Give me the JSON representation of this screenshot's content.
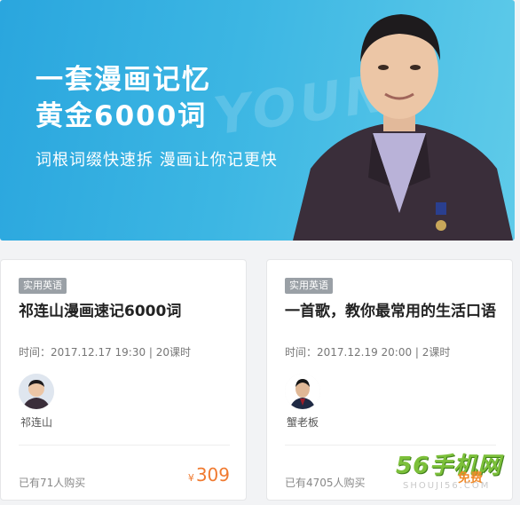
{
  "banner": {
    "title_line1": "一套漫画记忆",
    "title_line2": "黄金6000词",
    "subtitle": "词根词缀快速拆 漫画让你记更快",
    "watermark": "YOUNG"
  },
  "courses": [
    {
      "tag": "实用英语",
      "title": "祁连山漫画速记6000词",
      "time": "时间：2017.12.17 19:30 | 20课时",
      "teacher": "祁连山",
      "buyers": "已有71人购买",
      "currency": "¥",
      "price": "309"
    },
    {
      "tag": "实用英语",
      "title": "一首歌，教你最常用的生活口语",
      "time": "时间：2017.12.19 20:00 | 2课时",
      "teacher": "蟹老板",
      "buyers": "已有4705人购买"
    }
  ],
  "watermark_logo": {
    "text": "56手机网",
    "free": "免费",
    "domain": "SHOUJI56.COM"
  },
  "colors": {
    "banner_start": "#2aa6de",
    "banner_end": "#5fcbe9",
    "price": "#f07a30",
    "tag_bg": "#9aa0a6"
  }
}
